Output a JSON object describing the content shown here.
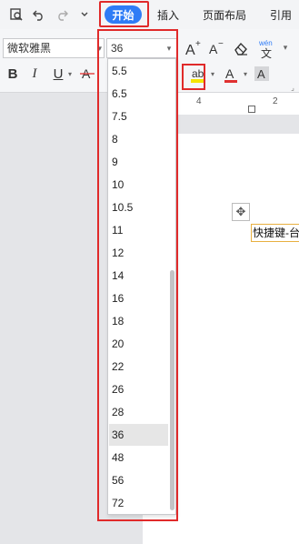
{
  "tabs": {
    "start_label": "开始",
    "insert_label": "插入",
    "layout_label": "页面布局",
    "ref_label": "引用"
  },
  "toolbar": {
    "font_name": "微软雅黑",
    "font_size": "36",
    "pinyin_label": "wén"
  },
  "ruler": {
    "ticks": [
      "4",
      "2"
    ]
  },
  "document": {
    "text": "快捷键-台"
  },
  "font_size_list": {
    "items": [
      "5.5",
      "6.5",
      "7.5",
      "8",
      "9",
      "10",
      "10.5",
      "11",
      "12",
      "14",
      "16",
      "18",
      "20",
      "22",
      "26",
      "28",
      "36",
      "48",
      "56",
      "72"
    ],
    "selected": "36"
  },
  "colors": {
    "accent": "#2f7cf6",
    "highlight_border": "#e02a2a",
    "text_highlight": "#f5e400",
    "font_color": "#e03030"
  }
}
